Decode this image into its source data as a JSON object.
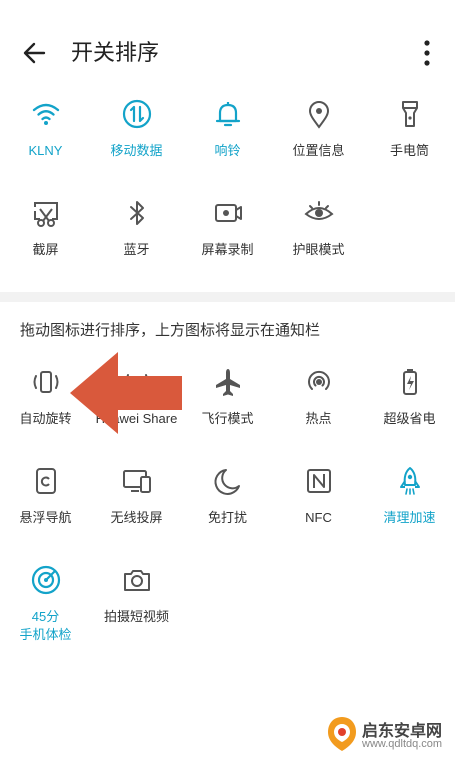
{
  "header": {
    "title": "开关排序"
  },
  "active_tiles": [
    {
      "label": "KLNY",
      "icon": "wifi-icon",
      "on": true
    },
    {
      "label": "移动数据",
      "icon": "mobile-data-icon",
      "on": true
    },
    {
      "label": "响铃",
      "icon": "bell-icon",
      "on": true
    },
    {
      "label": "位置信息",
      "icon": "location-icon",
      "on": false
    },
    {
      "label": "手电筒",
      "icon": "flashlight-icon",
      "on": false
    },
    {
      "label": "截屏",
      "icon": "screenshot-icon",
      "on": false
    },
    {
      "label": "蓝牙",
      "icon": "bluetooth-icon",
      "on": false
    },
    {
      "label": "屏幕录制",
      "icon": "screen-record-icon",
      "on": false
    },
    {
      "label": "护眼模式",
      "icon": "eye-comfort-icon",
      "on": false
    }
  ],
  "hint": "拖动图标进行排序，上方图标将显示在通知栏",
  "other_tiles": [
    {
      "label": "自动旋转",
      "icon": "auto-rotate-icon",
      "on": false
    },
    {
      "label": "Huawei Share",
      "icon": "huawei-share-icon",
      "on": false
    },
    {
      "label": "飞行模式",
      "icon": "airplane-icon",
      "on": false
    },
    {
      "label": "热点",
      "icon": "hotspot-icon",
      "on": false
    },
    {
      "label": "超级省电",
      "icon": "battery-saver-icon",
      "on": false
    },
    {
      "label": "悬浮导航",
      "icon": "floating-nav-icon",
      "on": false
    },
    {
      "label": "无线投屏",
      "icon": "wireless-projection-icon",
      "on": false
    },
    {
      "label": "免打扰",
      "icon": "moon-icon",
      "on": false
    },
    {
      "label": "NFC",
      "icon": "nfc-icon",
      "on": false
    },
    {
      "label": "清理加速",
      "icon": "rocket-icon",
      "on": true
    },
    {
      "label": "45分",
      "label2": "手机体检",
      "icon": "phone-checkup-icon",
      "on": true
    },
    {
      "label": "拍摄短视频",
      "icon": "camera-icon",
      "on": false
    }
  ],
  "watermark": {
    "name": "启东安卓网",
    "url": "www.qdltdq.com"
  },
  "colors": {
    "accent": "#13a3c9",
    "icon_gray": "#555555",
    "arrow": "#d9593c"
  }
}
